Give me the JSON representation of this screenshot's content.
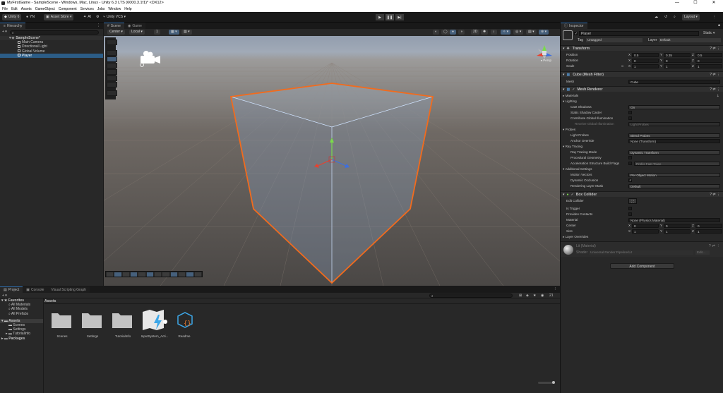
{
  "window": {
    "title": "MyFirstGame - SampleScene - Windows, Mac, Linux - Unity 6.3 LTS (6000.3.1f1)* <DX12>",
    "controls": [
      "—",
      "☐",
      "✕"
    ]
  },
  "menu": [
    "File",
    "Edit",
    "Assets",
    "GameObject",
    "Component",
    "Services",
    "Jobs",
    "Window",
    "Help"
  ],
  "toolbar": {
    "unity": "Unity 6",
    "account": "YN",
    "asset_store": "Asset Store ▾",
    "ai": "AI",
    "vcs": "Unity VCS ▾",
    "layout": "Layout ▾"
  },
  "hierarchy": {
    "tab": "Hierarchy",
    "items": [
      {
        "label": "SampleScene*",
        "level": 0
      },
      {
        "label": "Main Camera",
        "level": 1
      },
      {
        "label": "Directional Light",
        "level": 1
      },
      {
        "label": "Global Volume",
        "level": 1
      },
      {
        "label": "Player",
        "level": 1,
        "selected": true
      }
    ]
  },
  "scene": {
    "tabs": [
      "Scene",
      "Game"
    ],
    "pivot": "Center ▾",
    "space": "Local ▾",
    "snap": "1",
    "persp": "◂ Persp",
    "tools": [
      "view",
      "move",
      "rotate",
      "scale",
      "rect",
      "transform",
      "custom"
    ]
  },
  "inspector": {
    "tab": "Inspector",
    "object_name": "Player",
    "static": "Static ▾",
    "tag_label": "Tag",
    "tag": "Untagged",
    "layer_label": "Layer",
    "layer": "Default",
    "transform": {
      "title": "Transform",
      "position": {
        "label": "Position",
        "x": "0.5",
        "y": "0.35",
        "z": "0.5"
      },
      "rotation": {
        "label": "Rotation",
        "x": "0",
        "y": "0",
        "z": "0"
      },
      "scale": {
        "label": "Scale",
        "x": "1",
        "y": "1",
        "z": "1"
      }
    },
    "mesh_filter": {
      "title": "Cube (Mesh Filter)",
      "mesh_label": "Mesh",
      "mesh": "Cube"
    },
    "mesh_renderer": {
      "title": "Mesh Renderer",
      "materials_label": "Materials",
      "materials_count": "1",
      "lighting": "Lighting",
      "cast_shadows_label": "Cast Shadows",
      "cast_shadows": "On",
      "static_shadow_caster": "Static Shadow Caster",
      "contribute_gi": "Contribute Global Illumination",
      "receive_gi_label": "Receive Global Illumination",
      "receive_gi": "Light Probes",
      "probes": "Probes",
      "light_probes_label": "Light Probes",
      "light_probes": "Blend Probes",
      "anchor_override_label": "Anchor Override",
      "anchor_override": "None (Transform)",
      "ray_tracing": "Ray Tracing",
      "rt_mode_label": "Ray Tracing Mode",
      "rt_mode": "Dynamic Transform",
      "procedural_geometry": "Procedural Geometry",
      "accel_flags_label": "Acceleration Structure Build Flags",
      "accel_flags": "Prefer Fast Trace",
      "additional": "Additional Settings",
      "motion_vectors_label": "Motion Vectors",
      "motion_vectors": "Per Object Motion",
      "dynamic_occlusion": "Dynamic Occlusion",
      "rendering_layer_label": "Rendering Layer Mask",
      "rendering_layer": "Default"
    },
    "box_collider": {
      "title": "Box Collider",
      "edit_collider": "Edit Collider",
      "is_trigger": "Is Trigger",
      "provides_contacts": "Provides Contacts",
      "material_label": "Material",
      "material": "None (Physics Material)",
      "center": {
        "label": "Center",
        "x": "0",
        "y": "0",
        "z": "0"
      },
      "size": {
        "label": "Size",
        "x": "1",
        "y": "1",
        "z": "1"
      },
      "layer_overrides": "Layer Overrides"
    },
    "material": {
      "name": "Lit (Material)",
      "shader_label": "Shader",
      "shader": "Universal Render Pipeline/Lit",
      "edit": "Edit..."
    },
    "add_component": "Add Component"
  },
  "project": {
    "tabs": [
      "Project",
      "Console",
      "Visual Scripting Graph"
    ],
    "add": "+ ▾",
    "favorites": "Favorites",
    "fav_items": [
      "All Materials",
      "All Models",
      "All Prefabs"
    ],
    "assets_root": "Assets",
    "asset_tree": [
      "Scenes",
      "Settings",
      "TutorialInfo"
    ],
    "packages": "Packages",
    "breadcrumb": "Assets",
    "count": "21",
    "assets": [
      "Scenes",
      "Settings",
      "TutorialInfo",
      "InputSystem_Acti...",
      "Readme"
    ]
  },
  "colors": {
    "accent": "#3a79bb",
    "selection": "#2c5d87",
    "outline": "#f26b1d",
    "bg": "#282828"
  }
}
